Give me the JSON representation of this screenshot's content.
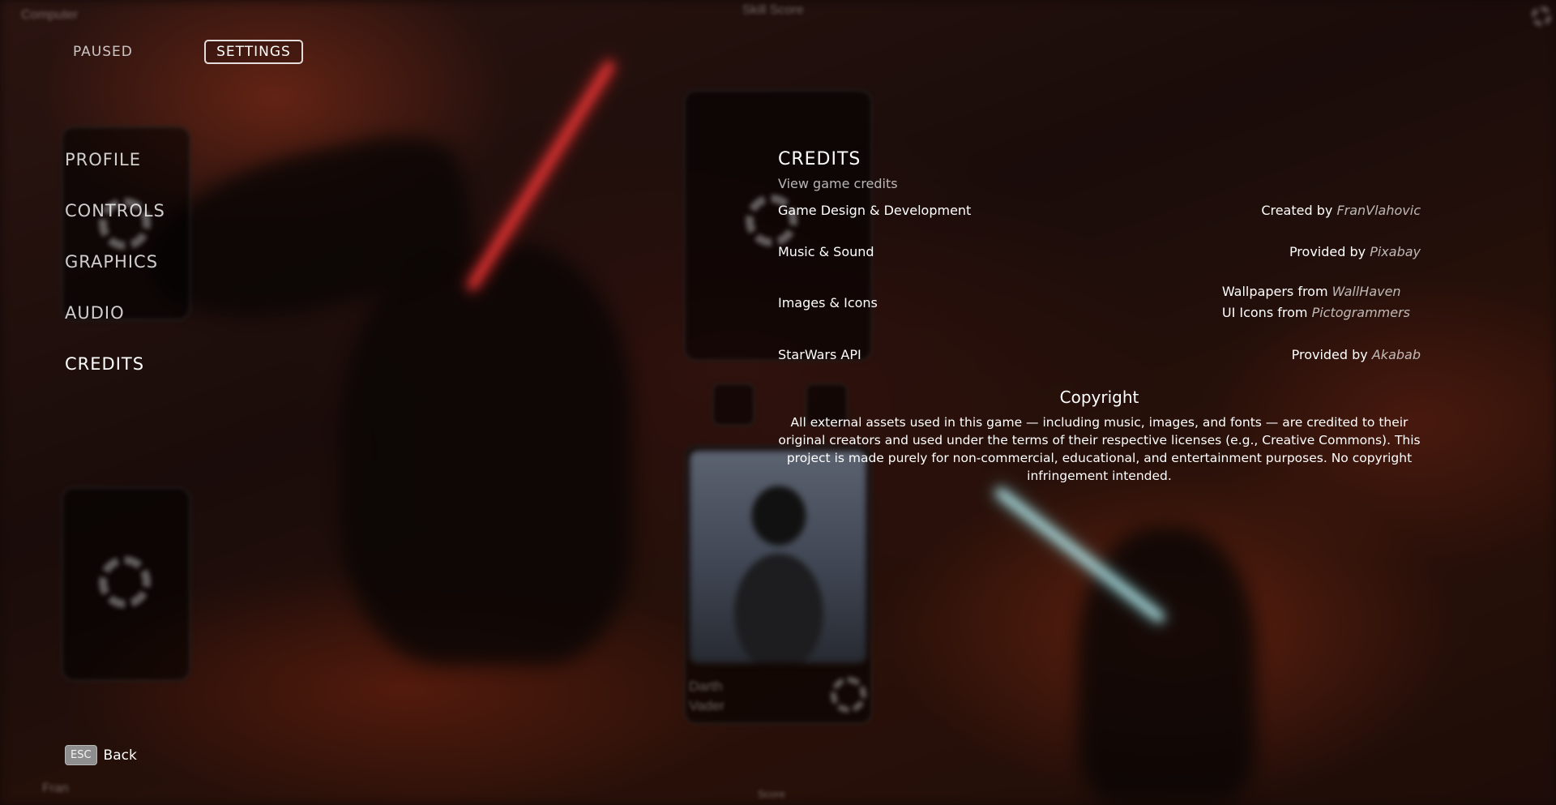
{
  "topbar": {
    "paused_label": "PAUSED",
    "settings_label": "SETTINGS"
  },
  "background": {
    "top_left_label": "Computer",
    "top_center_label": "Skill Score",
    "bottom_left_label": "Fran",
    "bottom_center_label": "Score",
    "card_name_line1": "Darth",
    "card_name_line2": "Vader"
  },
  "menu": {
    "items": [
      {
        "label": "PROFILE",
        "active": false
      },
      {
        "label": "CONTROLS",
        "active": false
      },
      {
        "label": "GRAPHICS",
        "active": false
      },
      {
        "label": "AUDIO",
        "active": false
      },
      {
        "label": "CREDITS",
        "active": true
      }
    ]
  },
  "credits": {
    "title": "CREDITS",
    "subtitle": "View game credits",
    "rows": [
      {
        "label": "Game Design & Development",
        "prefix": "Created by",
        "name": "FranVlahovic"
      },
      {
        "label": "Music & Sound",
        "prefix": "Provided by",
        "name": "Pixabay"
      },
      {
        "label": "Images & Icons",
        "lines": [
          {
            "prefix": "Wallpapers from",
            "name": "WallHaven"
          },
          {
            "prefix": "UI Icons from",
            "name": "Pictogrammers"
          }
        ]
      },
      {
        "label": "StarWars API",
        "prefix": "Provided by",
        "name": "Akabab"
      }
    ],
    "copyright_title": "Copyright",
    "copyright_text": "All external assets used in this game — including music, images, and fonts — are credited to their original creators and used under the terms of their respective licenses (e.g., Creative Commons). This project is made purely for non-commercial, educational, and entertainment purposes. No copyright infringement intended."
  },
  "back_hint": {
    "key": "ESC",
    "label": "Back"
  }
}
